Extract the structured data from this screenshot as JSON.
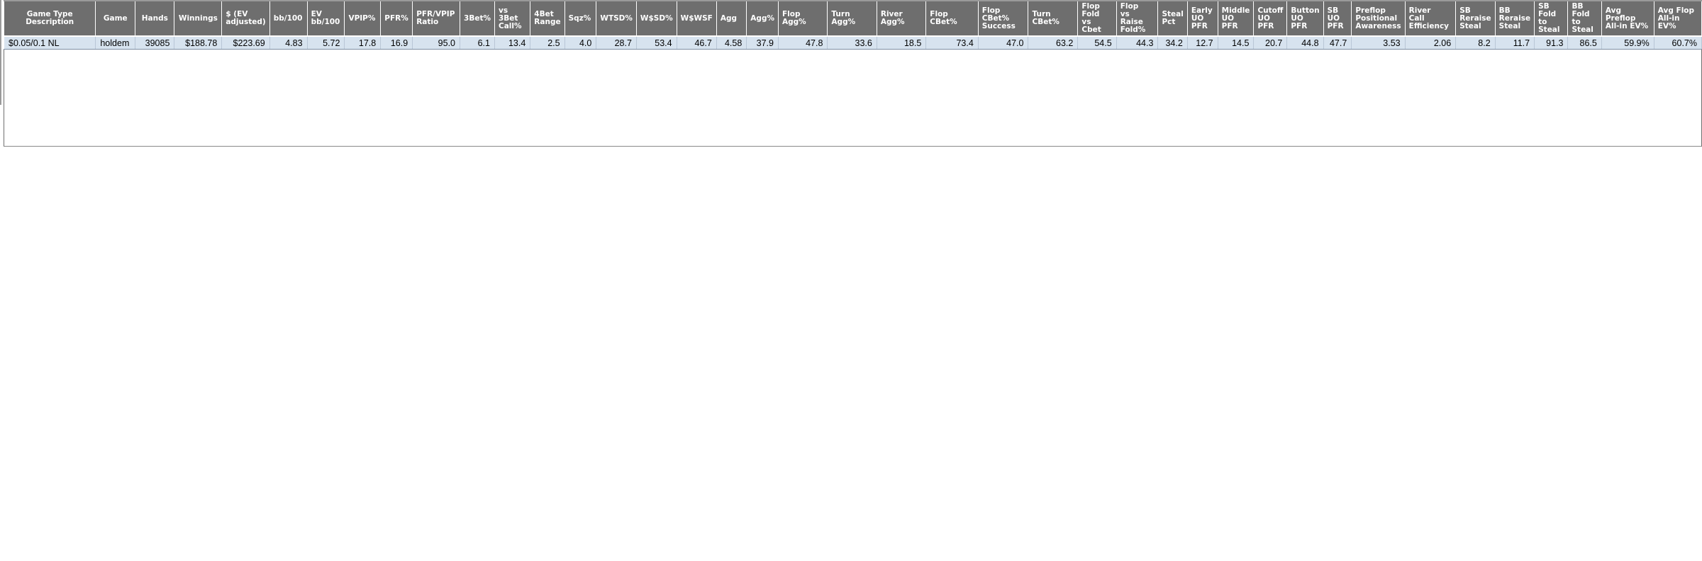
{
  "table": {
    "headers": [
      "Game Type Description",
      "Game",
      "Hands",
      "Winnings",
      "$ (EV\nadjusted)",
      "bb/100",
      "EV\nbb/100",
      "VPIP%",
      "PFR%",
      "PFR/VPIP\nRatio",
      "3Bet%",
      "vs 3Bet\nCall%",
      "4Bet\nRange",
      "Sqz%",
      "WTSD%",
      "W$SD%",
      "W$WSF",
      "Agg",
      "Agg%",
      "Flop Agg%",
      "Turn Agg%",
      "River Agg%",
      "Flop CBet%",
      "Flop CBet%\nSuccess",
      "Turn CBet%",
      "Flop\nFold\nvs Cbet",
      "Flop\nvs Raise\nFold%",
      "Steal\nPct",
      "Early\nUO\nPFR",
      "Middle\nUO\nPFR",
      "Cutoff\nUO\nPFR",
      "Button\nUO\nPFR",
      "SB\nUO\nPFR",
      "Preflop\nPositional\nAwareness",
      "River\nCall\nEfficiency",
      "SB\nReraise\nSteal",
      "BB\nReraise\nSteal",
      "SB\nFold to\nSteal",
      "BB\nFold to\nSteal",
      "Avg Preflop\nAll-in EV%",
      "Avg Flop\nAll-in EV%"
    ],
    "rows": [
      [
        "$0.05/0.1 NL",
        "holdem",
        "39085",
        "$188.78",
        "$223.69",
        "4.83",
        "5.72",
        "17.8",
        "16.9",
        "95.0",
        "6.1",
        "13.4",
        "2.5",
        "4.0",
        "28.7",
        "53.4",
        "46.7",
        "4.58",
        "37.9",
        "47.8",
        "33.6",
        "18.5",
        "73.4",
        "47.0",
        "63.2",
        "54.5",
        "44.3",
        "34.2",
        "12.7",
        "14.5",
        "20.7",
        "44.8",
        "47.7",
        "3.53",
        "2.06",
        "8.2",
        "11.7",
        "91.3",
        "86.5",
        "59.9%",
        "60.7%"
      ]
    ]
  }
}
